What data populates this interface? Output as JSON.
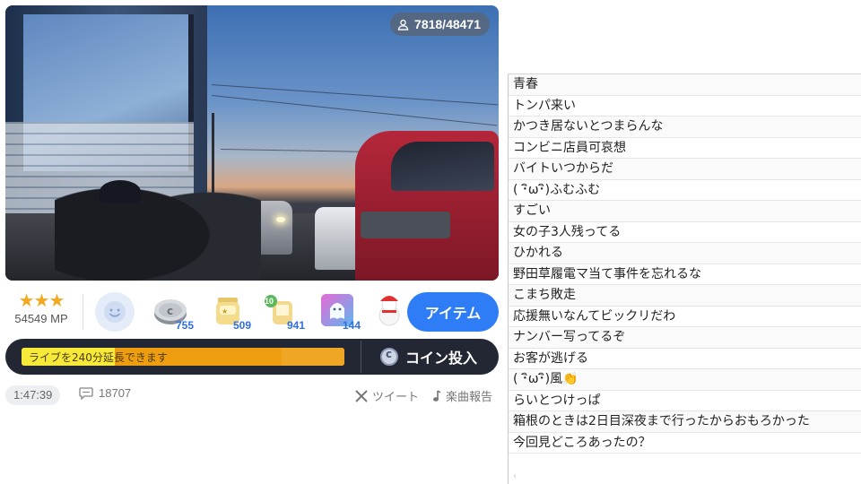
{
  "player": {
    "viewers": "7818/48471",
    "viewer_icon": "person-icon"
  },
  "gift_bar": {
    "stars": "★★★",
    "mp": "54549 MP",
    "smile_icon": "smile-icon",
    "gifts": [
      {
        "name": "coin-gift",
        "count": "755"
      },
      {
        "name": "jar-gift",
        "count": "509"
      },
      {
        "name": "cup-gift",
        "badge": "10",
        "count": "941"
      },
      {
        "name": "ghost-gift",
        "count": "144"
      },
      {
        "name": "snowman-gift"
      }
    ],
    "item_label": "アイテム"
  },
  "extend": {
    "label": "ライブを240分延長できます",
    "progress": 0.29,
    "coin_label": "コイン投入"
  },
  "info": {
    "elapsed": "1:47:39",
    "comment_count": "18707",
    "tweet_label": "ツイート",
    "report_label": "楽曲報告"
  },
  "comments": [
    "青春",
    "トンパ来い",
    "かつき居ないとつまらんな",
    "コンビニ店員可哀想",
    "バイトいつからだ",
    "( ･ิω･ิ)ふむふむ",
    "すごい",
    "女の子3人残ってる",
    "ひかれる",
    "野田草履電マ当て事件を忘れるな",
    "こまち敗走",
    "応援無いなんてビックリだわ",
    "ナンバー写ってるぞ",
    "お客が逃げる",
    "( ･ิω･ิ)風👏",
    "らいとつけっぱ",
    "箱根のときは2日目深夜まで行ったからおもろかった",
    "今回見どころあったの？"
  ],
  "colors": {
    "accent": "#2e7cf6",
    "stars": "#f3a81d",
    "extend_bg": "#232633",
    "progress_yellow": "#f6e93a",
    "progress_orange": "#ef9d10"
  }
}
